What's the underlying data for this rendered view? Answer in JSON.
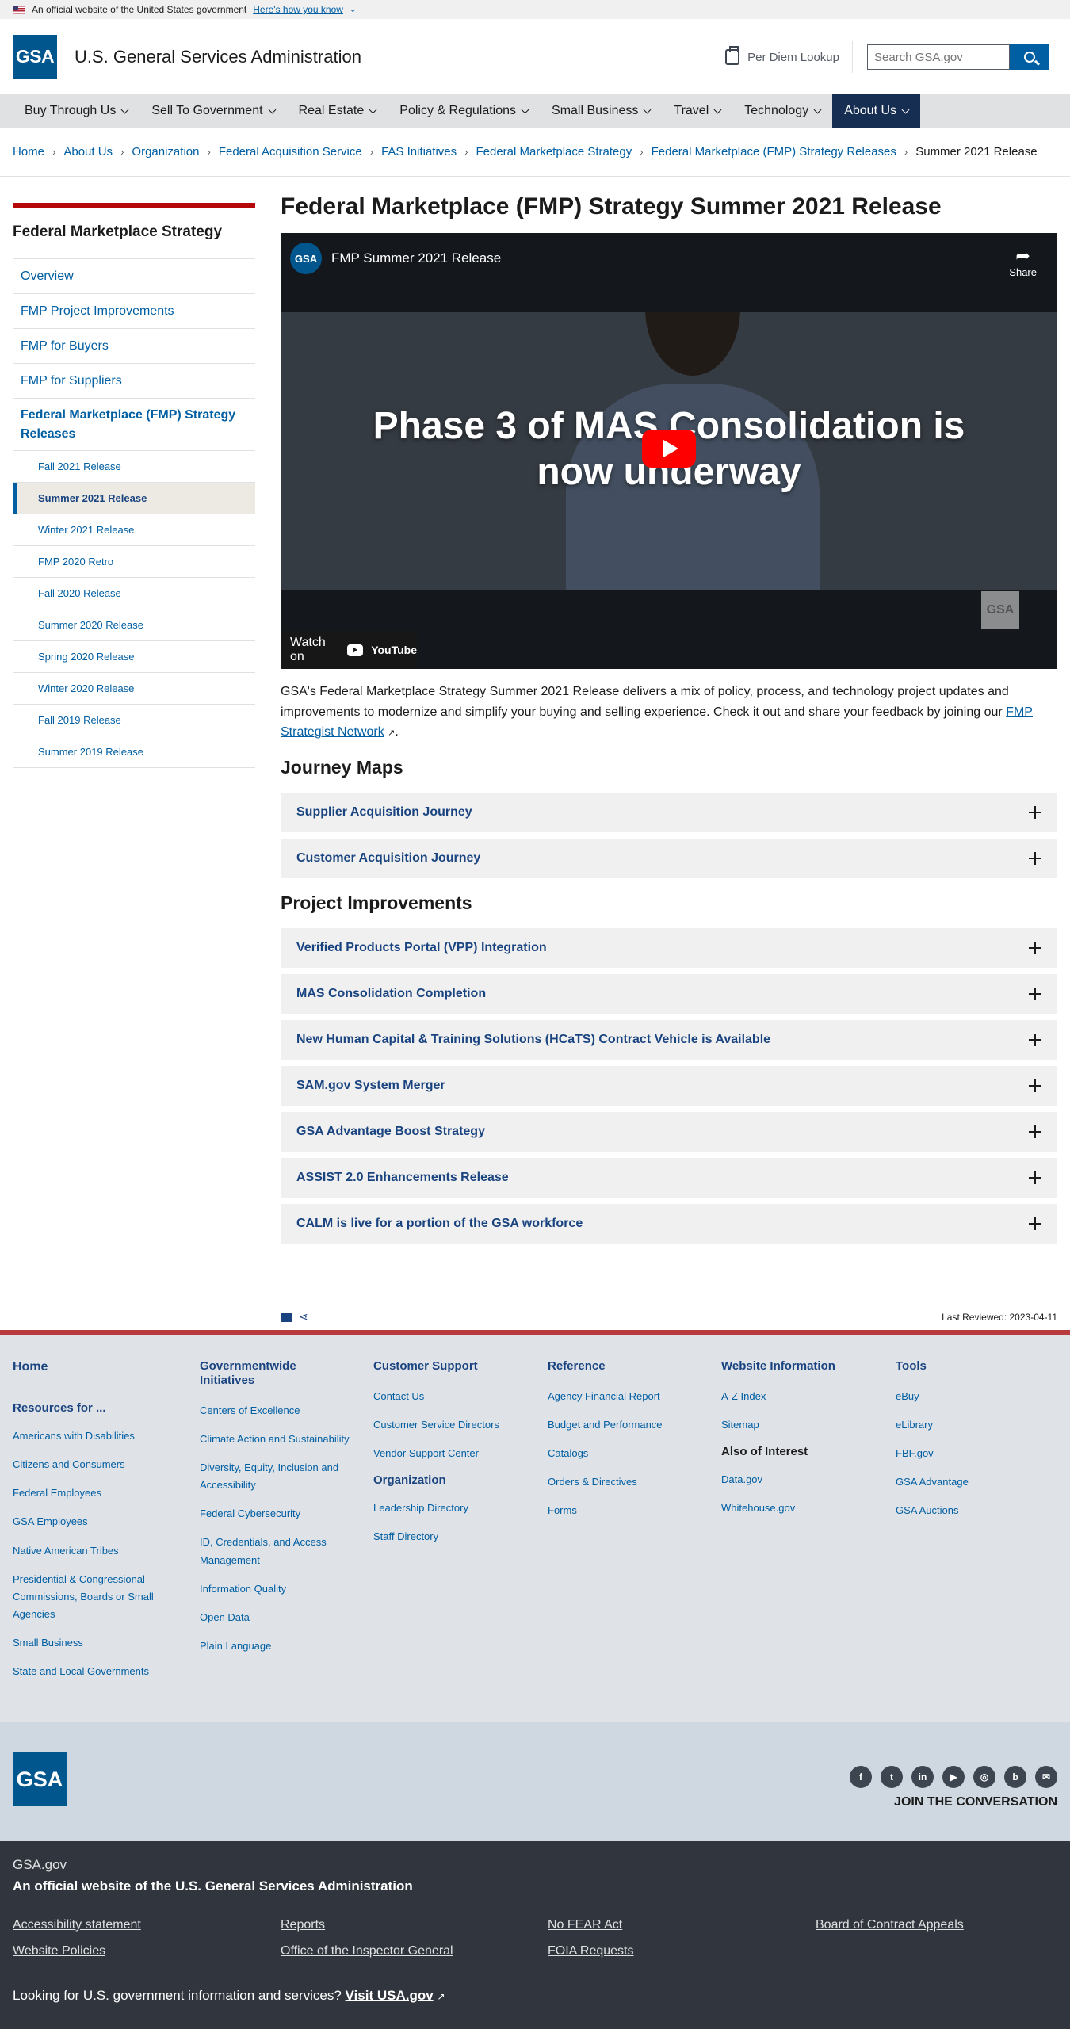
{
  "banner": {
    "text": "An official website of the United States government",
    "how": "Here's how you know"
  },
  "header": {
    "logo": "GSA",
    "site_name": "U.S. General Services Administration",
    "per_diem": "Per Diem Lookup",
    "search_placeholder": "Search GSA.gov"
  },
  "nav": [
    "Buy Through Us",
    "Sell To Government",
    "Real Estate",
    "Policy & Regulations",
    "Small Business",
    "Travel",
    "Technology",
    "About Us"
  ],
  "breadcrumbs": [
    "Home",
    "About Us",
    "Organization",
    "Federal Acquisition Service",
    "FAS Initiatives",
    "Federal Marketplace Strategy",
    "Federal Marketplace (FMP) Strategy Releases",
    "Summer 2021 Release"
  ],
  "sidenav": {
    "title": "Federal Marketplace Strategy",
    "items": [
      "Overview",
      "FMP Project Improvements",
      "FMP for Buyers",
      "FMP for Suppliers"
    ],
    "section": "Federal Marketplace (FMP) Strategy Releases",
    "subitems": [
      "Fall 2021 Release",
      "Summer 2021 Release",
      "Winter 2021 Release",
      "FMP 2020 Retro",
      "Fall 2020 Release",
      "Summer 2020 Release",
      "Spring 2020 Release",
      "Winter 2020 Release",
      "Fall 2019 Release",
      "Summer 2019 Release"
    ]
  },
  "main": {
    "title": "Federal Marketplace (FMP) Strategy Summer 2021 Release",
    "video": {
      "channel": "GSA",
      "title": "FMP Summer 2021 Release",
      "share": "Share",
      "headline": "Phase 3 of MAS Consolidation is now underway",
      "watch": "Watch on",
      "youtube": "YouTube",
      "watermark": "GSA"
    },
    "intro": "GSA's Federal Marketplace Strategy Summer 2021 Release delivers a mix of policy, process, and technology project updates and improvements to modernize and simplify your buying and selling experience. Check it out and share your feedback by joining our ",
    "intro_link": "FMP Strategist Network",
    "intro_end": ".",
    "journey_heading": "Journey Maps",
    "journeys": [
      "Supplier Acquisition Journey",
      "Customer Acquisition Journey"
    ],
    "projects_heading": "Project Improvements",
    "projects": [
      "Verified Products Portal (VPP) Integration",
      "MAS Consolidation Completion",
      "New Human Capital & Training Solutions (HCaTS) Contract Vehicle is Available",
      "SAM.gov System Merger",
      "GSA Advantage Boost Strategy",
      "ASSIST 2.0 Enhancements Release",
      "CALM is live for a portion of the GSA workforce"
    ],
    "last_reviewed": "Last Reviewed: 2023-04-11"
  },
  "footer": {
    "home": "Home",
    "resources_heading": "Resources for ...",
    "resources": [
      "Americans with Disabilities",
      "Citizens and Consumers",
      "Federal Employees",
      "GSA Employees",
      "Native American Tribes",
      "Presidential & Congressional Commissions, Boards or Small Agencies",
      "Small Business",
      "State and Local Governments"
    ],
    "gov_heading": "Governmentwide Initiatives",
    "gov": [
      "Centers of Excellence",
      "Climate Action and Sustainability",
      "Diversity, Equity, Inclusion and Accessibility",
      "Federal Cybersecurity",
      "ID, Credentials, and Access Management",
      "Information Quality",
      "Open Data",
      "Plain Language"
    ],
    "support_heading": "Customer Support",
    "support": [
      "Contact Us",
      "Customer Service Directors",
      "Vendor Support Center"
    ],
    "org_heading": "Organization",
    "org": [
      "Leadership Directory",
      "Staff Directory"
    ],
    "reference_heading": "Reference",
    "reference": [
      "Agency Financial Report",
      "Budget and Performance",
      "Catalogs",
      "Orders & Directives",
      "Forms"
    ],
    "website_heading": "Website Information",
    "website": [
      "A-Z Index",
      "Sitemap"
    ],
    "interest_heading": "Also of Interest",
    "interest": [
      "Data.gov",
      "Whitehouse.gov"
    ],
    "tools_heading": "Tools",
    "tools": [
      "eBuy",
      "eLibrary",
      "FBF.gov",
      "GSA Advantage",
      "GSA Auctions"
    ]
  },
  "identity": {
    "logo": "GSA",
    "socials": [
      "facebook-icon",
      "twitter-icon",
      "linkedin-icon",
      "youtube-icon",
      "instagram-icon",
      "blog-icon",
      "email-icon"
    ],
    "join": "JOIN THE CONVERSATION"
  },
  "govfooter": {
    "site": "GSA.gov",
    "official": "An official website of the U.S. General Services Administration",
    "links": [
      "Accessibility statement",
      "Reports",
      "No FEAR Act",
      "Board of Contract Appeals",
      "Website Policies",
      "Office of the Inspector General",
      "FOIA Requests"
    ],
    "usa_text": "Looking for U.S. government information and services? ",
    "usa_link": "Visit USA.gov"
  }
}
